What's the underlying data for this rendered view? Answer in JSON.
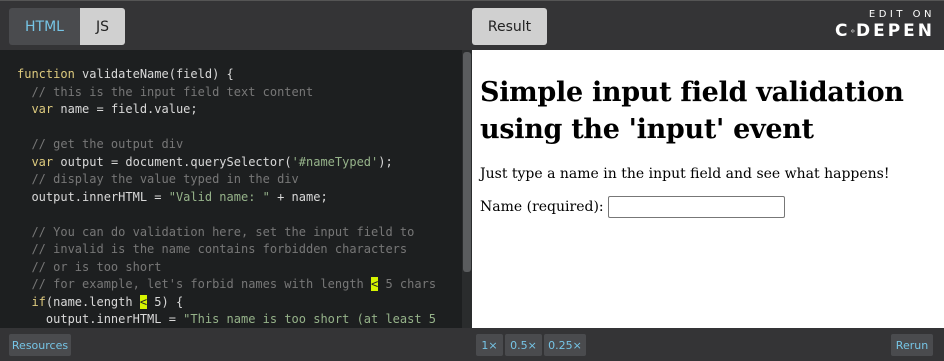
{
  "tabs": {
    "html": "HTML",
    "js": "JS",
    "result": "Result"
  },
  "brand": {
    "top": "EDIT ON",
    "name_left": "C",
    "name_right": "DEPEN"
  },
  "code_lines": [
    [
      [
        "k",
        "function"
      ],
      [
        "p",
        " validateName(field) {"
      ]
    ],
    [
      [
        "c",
        "  // this is the input field text content"
      ]
    ],
    [
      [
        "p",
        "  "
      ],
      [
        "k",
        "var"
      ],
      [
        "p",
        " name = field.value;"
      ]
    ],
    [
      [
        "p",
        ""
      ]
    ],
    [
      [
        "c",
        "  // get the output div"
      ]
    ],
    [
      [
        "p",
        "  "
      ],
      [
        "k",
        "var"
      ],
      [
        "p",
        " output = document.querySelector("
      ],
      [
        "s",
        "'#nameTyped'"
      ],
      [
        "p",
        ");"
      ]
    ],
    [
      [
        "c",
        "  // display the value typed in the div"
      ]
    ],
    [
      [
        "p",
        "  output.innerHTML = "
      ],
      [
        "s",
        "\"Valid name: \""
      ],
      [
        "p",
        " + name;"
      ]
    ],
    [
      [
        "p",
        ""
      ]
    ],
    [
      [
        "c",
        "  // You can do validation here, set the input field to"
      ]
    ],
    [
      [
        "c",
        "  // invalid is the name contains forbidden characters"
      ]
    ],
    [
      [
        "c",
        "  // or is too short"
      ]
    ],
    [
      [
        "c",
        "  // for example, let's forbid names with length "
      ],
      [
        "hl",
        "<"
      ],
      [
        "c",
        " 5 chars"
      ]
    ],
    [
      [
        "p",
        "  "
      ],
      [
        "k",
        "if"
      ],
      [
        "p",
        "(name.length "
      ],
      [
        "hl",
        "<"
      ],
      [
        "p",
        " 5) {"
      ]
    ],
    [
      [
        "p",
        "    output.innerHTML = "
      ],
      [
        "s",
        "\"This name is too short (at least 5"
      ]
    ]
  ],
  "result": {
    "title": "Simple input field validation using the 'input' event",
    "instruction": "Just type a name in the input field and see what happens!",
    "field_label": "Name (required):",
    "field_value": ""
  },
  "bottom": {
    "resources": "Resources",
    "zoom_1x": "1×",
    "zoom_05x": "0.5×",
    "zoom_025x": "0.25×",
    "rerun": "Rerun"
  }
}
